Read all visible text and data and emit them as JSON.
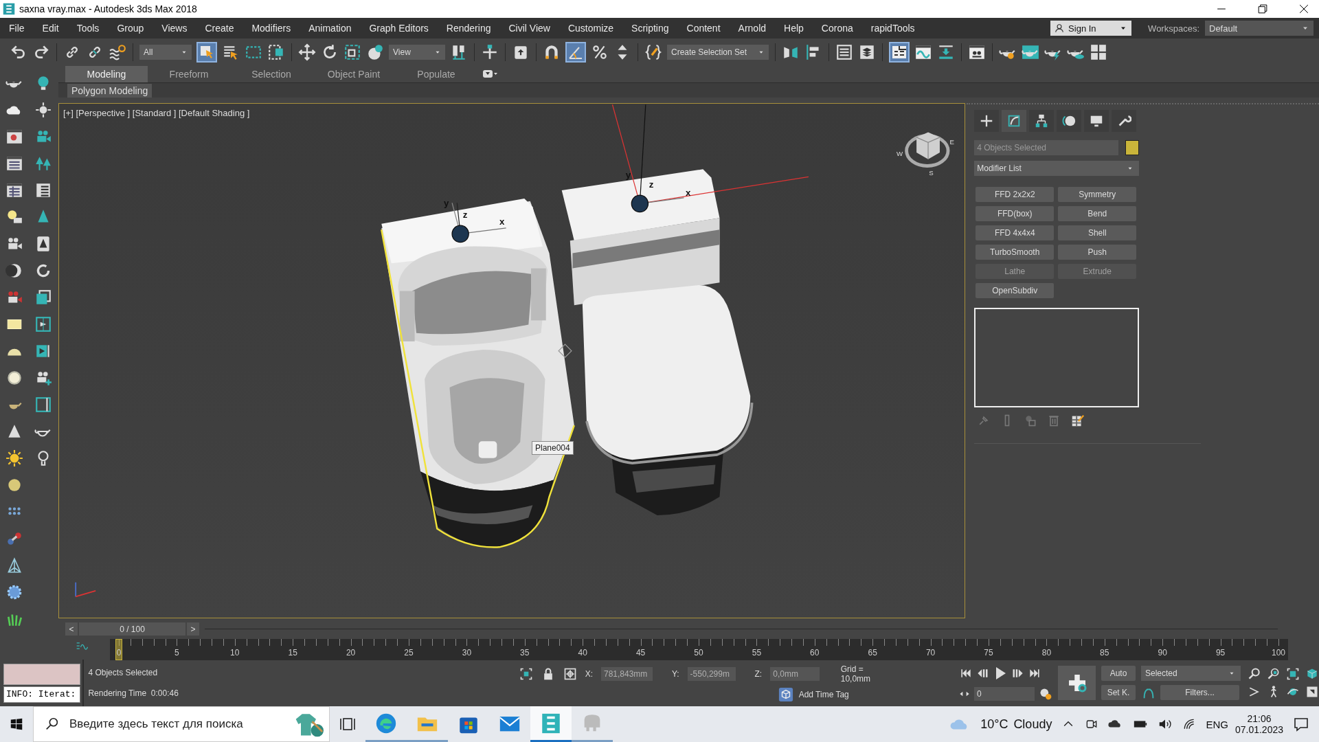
{
  "window": {
    "title": "saxna vray.max - Autodesk 3ds Max 2018"
  },
  "menu": [
    {
      "label": "File"
    },
    {
      "label": "Edit"
    },
    {
      "label": "Tools"
    },
    {
      "label": "Group"
    },
    {
      "label": "Views"
    },
    {
      "label": "Create"
    },
    {
      "label": "Modifiers"
    },
    {
      "label": "Animation"
    },
    {
      "label": "Graph Editors"
    },
    {
      "label": "Rendering"
    },
    {
      "label": "Civil View"
    },
    {
      "label": "Customize"
    },
    {
      "label": "Scripting"
    },
    {
      "label": "Content"
    },
    {
      "label": "Arnold"
    },
    {
      "label": "Help"
    },
    {
      "label": "Corona"
    },
    {
      "label": "rapidTools"
    }
  ],
  "account": {
    "label": "Sign In"
  },
  "workspaces": {
    "label": "Workspaces:",
    "value": "Default"
  },
  "main_toolbar": {
    "selection_filter": "All",
    "reference_coordinate": "View",
    "named_selection": "Create Selection Set",
    "select_object_on": true,
    "angle_snap_on": true,
    "ribbon_on": true
  },
  "ribbon": {
    "tabs": [
      {
        "label": "Modeling",
        "selected": true
      },
      {
        "label": "Freeform",
        "selected": false
      },
      {
        "label": "Selection",
        "selected": false
      },
      {
        "label": "Object Paint",
        "selected": false
      },
      {
        "label": "Populate",
        "selected": false
      }
    ],
    "panel": "Polygon Modeling"
  },
  "viewport": {
    "label": "[+] [Perspective ] [Standard ] [Default Shading ]",
    "tooltip": "Plane004",
    "axis_labels": [
      "y",
      "z",
      "x",
      "y",
      "z",
      "x"
    ],
    "compass": [
      "W",
      "S",
      "E"
    ]
  },
  "command_panel": {
    "tabs": [
      {
        "selected": false
      },
      {
        "selected": true
      },
      {
        "selected": false
      },
      {
        "selected": false
      },
      {
        "selected": false
      },
      {
        "selected": false
      }
    ],
    "object": {
      "name": "4 Objects Selected",
      "color": "#c9b43a"
    },
    "modifier_list": "Modifier List",
    "modifiers": [
      {
        "label": "FFD 2x2x2",
        "disabled": false
      },
      {
        "label": "Symmetry",
        "disabled": false
      },
      {
        "label": "FFD(box)",
        "disabled": false
      },
      {
        "label": "Bend",
        "disabled": false
      },
      {
        "label": "FFD 4x4x4",
        "disabled": false
      },
      {
        "label": "Shell",
        "disabled": false
      },
      {
        "label": "TurboSmooth",
        "disabled": false
      },
      {
        "label": "Push",
        "disabled": false
      },
      {
        "label": "Lathe",
        "disabled": true
      },
      {
        "label": "Extrude",
        "disabled": true
      },
      {
        "label": "OpenSubdiv",
        "disabled": false
      }
    ]
  },
  "time_slider": {
    "prev": "<",
    "position": "0 / 100",
    "next": ">",
    "level": 0,
    "ticks": [
      "0",
      "5",
      "10",
      "15",
      "20",
      "25",
      "30",
      "35",
      "40",
      "45",
      "50",
      "55",
      "60",
      "65",
      "70",
      "75",
      "80",
      "85",
      "90",
      "95",
      "100"
    ]
  },
  "status": {
    "listener": "INFO: Iterat:",
    "selection": "4 Objects Selected",
    "render_time": "Rendering Time  0:00:46",
    "x": {
      "label": "X:",
      "value": "781,843mm"
    },
    "y": {
      "label": "Y:",
      "value": "-550,299m"
    },
    "z": {
      "label": "Z:",
      "value": "0,0mm"
    },
    "grid": "Grid = 10,0mm",
    "time_tag": "Add Time Tag",
    "frame": "0",
    "auto_key": "Auto",
    "key_mode": "Selected",
    "set_key": "Set K.",
    "filters": "Filters..."
  },
  "taskbar": {
    "search_placeholder": "Введите здесь текст для поиска",
    "apps": [
      {
        "selected": false,
        "running": true
      },
      {
        "selected": false,
        "running": true
      },
      {
        "selected": false,
        "running": false
      },
      {
        "selected": false,
        "running": false
      },
      {
        "selected": true,
        "running": true
      },
      {
        "selected": false,
        "running": true
      }
    ],
    "weather": {
      "temperature": "10°C",
      "condition": "Cloudy"
    },
    "language": "ENG",
    "time": "21:06",
    "date": "07.01.2023"
  }
}
